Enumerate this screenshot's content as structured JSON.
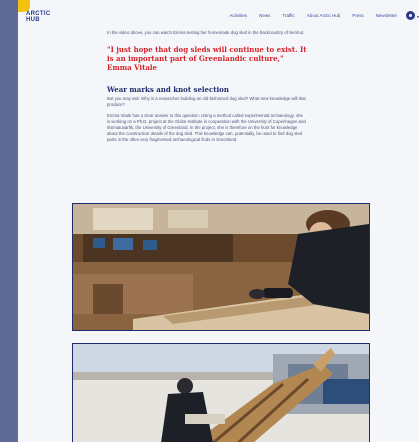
{
  "brand": {
    "logo_line1": "ARCTIC",
    "logo_line2": "HUB"
  },
  "nav": {
    "items": [
      {
        "label": "Activities"
      },
      {
        "label": "News"
      },
      {
        "label": "Traffic"
      },
      {
        "label": "About Arctic Hub"
      },
      {
        "label": "Press"
      },
      {
        "label": "Newsletter"
      }
    ]
  },
  "article": {
    "intro": "In the video above, you can watch Emma testing her homemade dog sled in the backcountry of Nermut.",
    "quote": "\"I just hope that dog sleds will continue to exist. It is an important part of Greenlandic culture,\"",
    "quote_author": "Emma Vitale",
    "heading": "Wear marks and knot selection",
    "para1": "But you may ask: Why is a researcher building an old-fashioned dog sled? What new knowledge will that produce?",
    "para2": "Emma Vitale has a clear answer to this question: Using a method called experimental archaeology, she is working on a Ph.D. project at the Globe Institute in cooperation with the University of Copenhagen and Ilisimatusarfik, the University of Greenland. In the project, she is therefore on the hunt for knowledge about the construction details of the dog sled. This knowledge can, potentially, be used to find dog sled parts in the often very fragmented archaeological finds in Greenland."
  }
}
